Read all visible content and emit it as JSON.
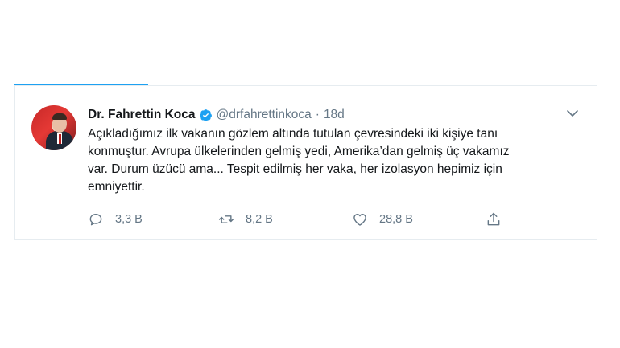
{
  "tweet": {
    "author_name": "Dr. Fahrettin Koca",
    "handle": "@drfahrettinkoca",
    "separator": "·",
    "time": "18d",
    "lines": [
      "Açıkladığımız ilk vakanın gözlem altında tutulan çevresindeki iki kişiye tanı",
      "konmuştur. Avrupa ülkelerinden gelmiş yedi, Amerika’dan gelmiş üç vakamız",
      "var. Durum üzücü ama... Tespit edilmiş her vaka, her izolasyon hepimiz için",
      "emniyettir."
    ],
    "actions": {
      "replies": "3,3 B",
      "retweets": "8,2 B",
      "likes": "28,8 B"
    }
  },
  "icons": {
    "verified": "verified-badge-icon",
    "more": "chevron-down-icon",
    "reply": "reply-icon",
    "retweet": "retweet-icon",
    "like": "heart-icon",
    "share": "share-icon"
  },
  "colors": {
    "accent": "#1da1f2",
    "text": "#14171a",
    "muted": "#657786",
    "border": "#e6ecf0"
  }
}
